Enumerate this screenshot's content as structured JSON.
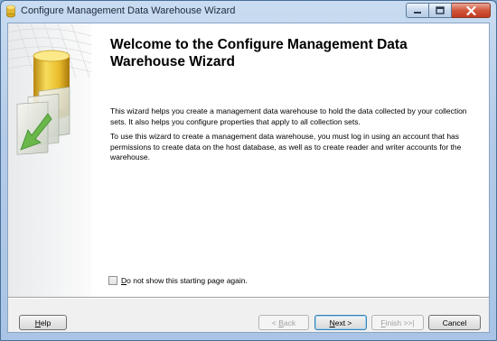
{
  "window": {
    "title": "Configure Management Data Warehouse Wizard"
  },
  "header": {
    "title": "Welcome to the Configure Management Data Warehouse Wizard"
  },
  "body": {
    "paragraph1": "This wizard helps you create a management data warehouse to hold the data collected by your collection sets. It also helps you configure properties that apply to all collection sets.",
    "paragraph2": "To use this wizard to create a management data warehouse, you must log in using an account that has permissions to create data on the host database, as well as to create reader and writer accounts for the warehouse."
  },
  "options": {
    "dont_show_label_mnemonic": "D",
    "dont_show_label_rest": "o not show this starting page again.",
    "dont_show_checked": false
  },
  "buttons": {
    "help_mnemonic": "H",
    "help_rest": "elp",
    "back_prefix": "< ",
    "back_mnemonic": "B",
    "back_rest": "ack",
    "next_mnemonic": "N",
    "next_rest": "ext >",
    "finish_mnemonic": "F",
    "finish_rest": "inish >>|",
    "cancel": "Cancel"
  },
  "colors": {
    "title_bar": "#b8d0ea",
    "close_button": "#c8462a",
    "graphic_gold": "#e8c33a",
    "graphic_arrow": "#6ab84a"
  }
}
